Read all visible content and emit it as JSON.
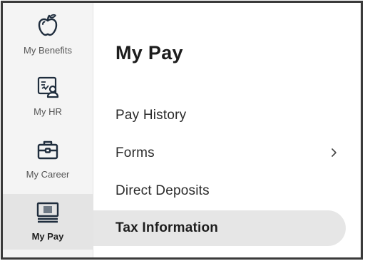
{
  "sidebar": {
    "items": [
      {
        "label": "My Benefits",
        "icon": "apple-icon",
        "active": false
      },
      {
        "label": "My HR",
        "icon": "hr-profile-icon",
        "active": false
      },
      {
        "label": "My Career",
        "icon": "briefcase-icon",
        "active": false
      },
      {
        "label": "My Pay",
        "icon": "pay-icon",
        "active": true
      }
    ]
  },
  "main": {
    "title": "My Pay",
    "menu": [
      {
        "label": "Pay History",
        "has_submenu": false
      },
      {
        "label": "Forms",
        "has_submenu": true
      },
      {
        "label": "Direct Deposits",
        "has_submenu": false
      },
      {
        "label": "Tax Information",
        "has_submenu": false,
        "active": true
      }
    ]
  },
  "colors": {
    "sidebar_bg": "#f4f4f4",
    "active_bg": "#e6e6e6",
    "icon": "#1f2d3d",
    "text": "#1d1d1d",
    "border": "#3a3a3a"
  }
}
